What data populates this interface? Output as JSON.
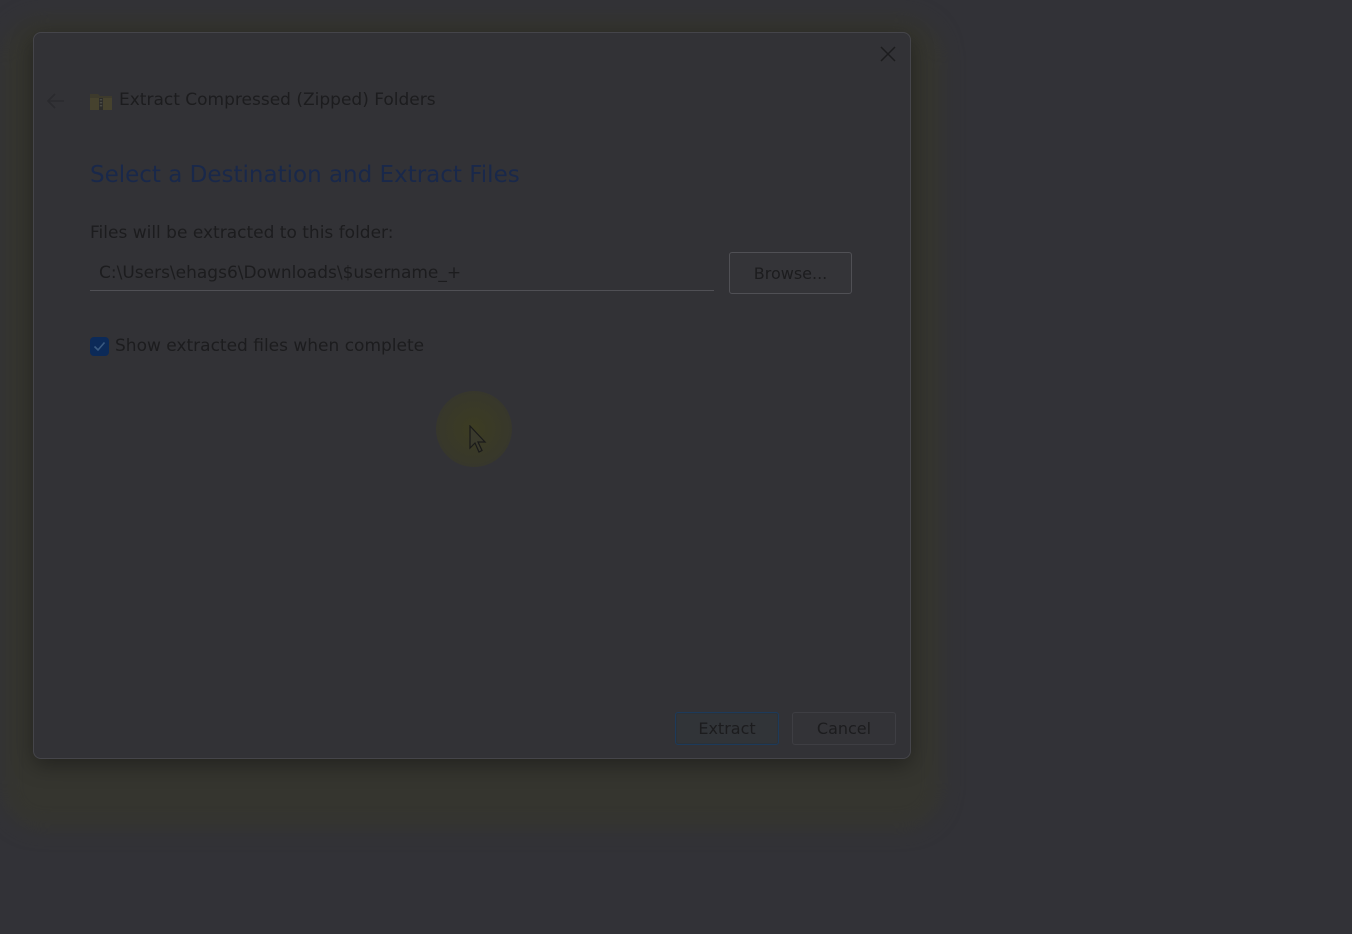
{
  "window": {
    "title": "Extract Compressed (Zipped) Folders",
    "close_icon": "close-icon",
    "back_icon": "back-arrow-icon",
    "app_icon": "zipped-folder-icon"
  },
  "content": {
    "heading": "Select a Destination and Extract Files",
    "path_label": "Files will be extracted to this folder:",
    "path_value": "C:\\Users\\ehags6\\Downloads\\$username_+",
    "browse_label": "Browse...",
    "show_files_checkbox": {
      "label": "Show extracted files when complete",
      "checked": true
    }
  },
  "footer": {
    "extract_label": "Extract",
    "cancel_label": "Cancel"
  },
  "colors": {
    "background": "#323237",
    "heading": "#19284a",
    "checkbox_fill": "#0c2a58",
    "cursor_highlight": "#3c3c22"
  }
}
